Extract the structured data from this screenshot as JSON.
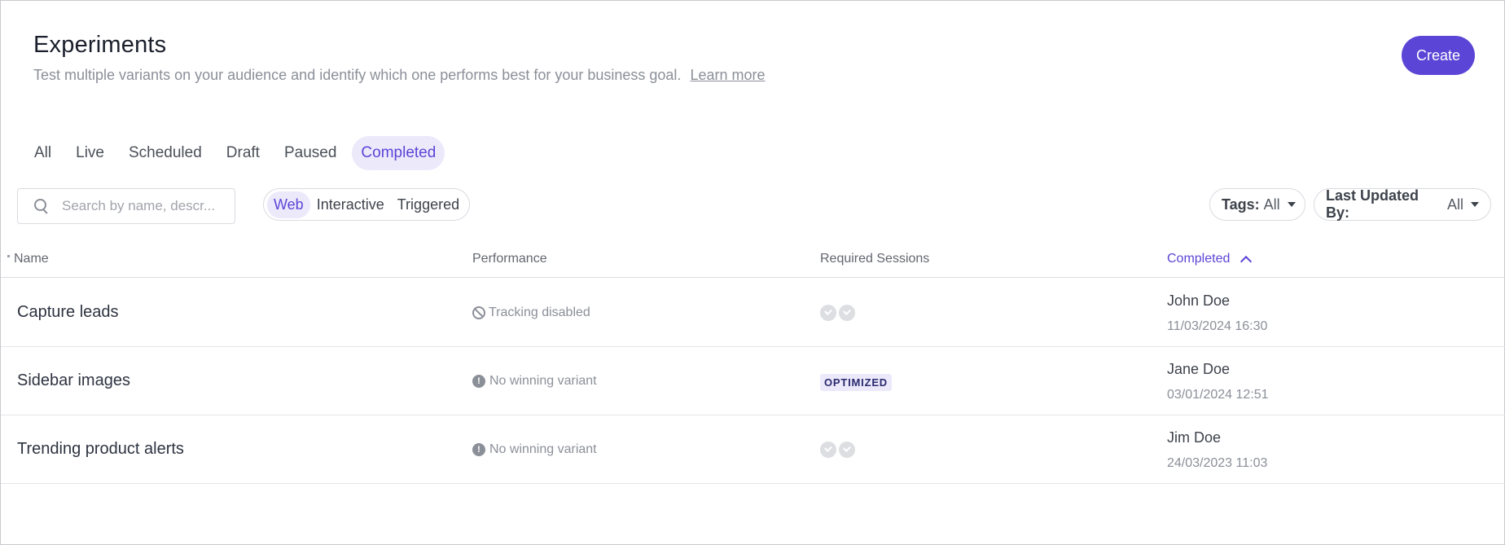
{
  "header": {
    "title": "Experiments",
    "subtitle": "Test multiple variants on your audience and identify which one performs best for your business goal.",
    "learn_more": "Learn more",
    "create_label": "Create"
  },
  "tabs": [
    {
      "label": "All",
      "active": false
    },
    {
      "label": "Live",
      "active": false
    },
    {
      "label": "Scheduled",
      "active": false
    },
    {
      "label": "Draft",
      "active": false
    },
    {
      "label": "Paused",
      "active": false
    },
    {
      "label": "Completed",
      "active": true
    }
  ],
  "search": {
    "placeholder": "Search by name, descr..."
  },
  "type_filter": [
    {
      "label": "Web",
      "active": true
    },
    {
      "label": "Interactive",
      "active": false
    },
    {
      "label": "Triggered",
      "active": false
    }
  ],
  "filters": {
    "tags": {
      "label": "Tags:",
      "value": "All"
    },
    "updated_by": {
      "label": "Last Updated By:",
      "value": "All"
    }
  },
  "table": {
    "columns": {
      "name": "Name",
      "performance": "Performance",
      "sessions": "Required Sessions",
      "completed": "Completed"
    },
    "rows": [
      {
        "name": "Capture leads",
        "performance": "Tracking disabled",
        "perf_icon": "ban-icon",
        "sessions": "dots",
        "completed_by": "John Doe",
        "completed_at": "11/03/2024 16:30"
      },
      {
        "name": "Sidebar images",
        "performance": "No winning variant",
        "perf_icon": "warning-icon",
        "sessions": "OPTIMIZED",
        "completed_by": "Jane Doe",
        "completed_at": "03/01/2024 12:51"
      },
      {
        "name": "Trending product alerts",
        "performance": "No winning variant",
        "perf_icon": "warning-icon",
        "sessions": "dots",
        "completed_by": "Jim Doe",
        "completed_at": "24/03/2023 11:03"
      }
    ]
  },
  "colors": {
    "accent": "#5b45d6",
    "accent_bg": "#ece9fb"
  }
}
